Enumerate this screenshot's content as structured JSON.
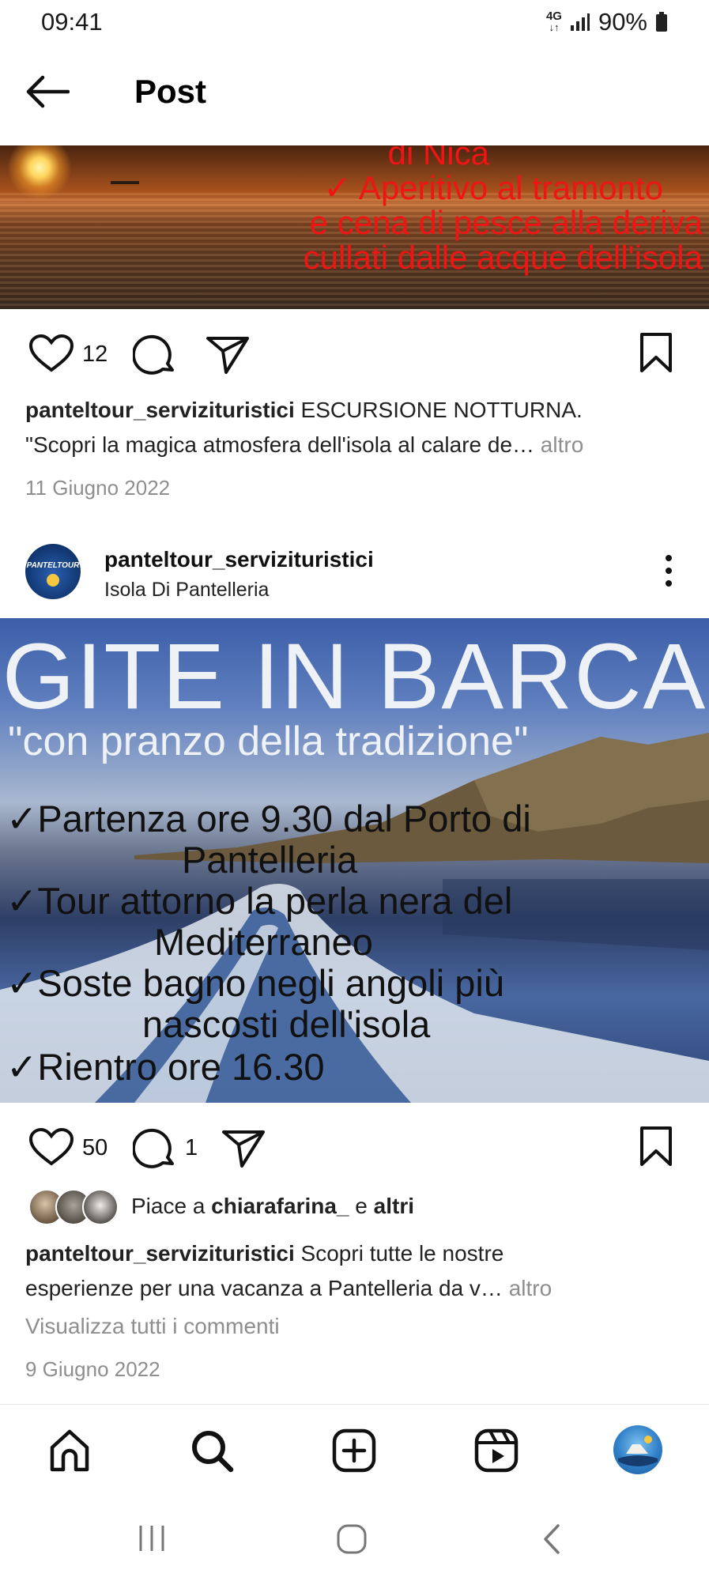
{
  "status_bar": {
    "time": "09:41",
    "network": "4G",
    "battery": "90%"
  },
  "header": {
    "title": "Post"
  },
  "post1": {
    "overlay_lines": [
      "di Nica",
      "✓ Aperitivo al tramonto",
      "e cena di pesce alla deriva",
      "cullati dalle acque dell'isola"
    ],
    "likes_count": "12",
    "caption_user": "panteltour_servizituristici",
    "caption_text": " ESCURSIONE NOTTURNA.",
    "caption_line2": "\"Scopri la magica atmosfera dell'isola al calare de…",
    "more_label": " altro",
    "date": "11 Giugno 2022"
  },
  "post2": {
    "username": "panteltour_servizituristici",
    "location": "Isola Di Pantelleria",
    "avatar_text": "PANTELTOUR",
    "image": {
      "title": "GITE IN BARCA",
      "subtitle": "\"con pranzo della tradizione\"",
      "lines": [
        "✓Partenza ore 9.30 dal Porto di",
        "Pantelleria",
        "✓Tour attorno la perla nera del",
        "Mediterraneo",
        "✓Soste bagno negli angoli più",
        "nascosti dell'isola",
        "✓Rientro ore 16.30"
      ]
    },
    "likes_count": "50",
    "comments_count": "1",
    "liked_by_prefix": "Piace a ",
    "liked_by_user": "chiarafarina_",
    "liked_by_mid": " e ",
    "liked_by_others": "altri",
    "caption_user": "panteltour_servizituristici",
    "caption_text": " Scopri tutte le nostre",
    "caption_line2": "esperienze per una vacanza  a Pantelleria da v…",
    "more_label": " altro",
    "view_comments": "Visualizza tutti i commenti",
    "date": "9 Giugno 2022"
  },
  "icons": {
    "back": "arrow-left-icon",
    "like": "heart-icon",
    "comment": "comment-icon",
    "share": "send-icon",
    "save": "bookmark-icon",
    "more": "more-vertical-icon",
    "home": "home-icon",
    "search": "search-icon",
    "create": "plus-square-icon",
    "reels": "reels-icon"
  },
  "colors": {
    "overlay_red": "#f01414",
    "muted_text": "#8e8e8e"
  }
}
